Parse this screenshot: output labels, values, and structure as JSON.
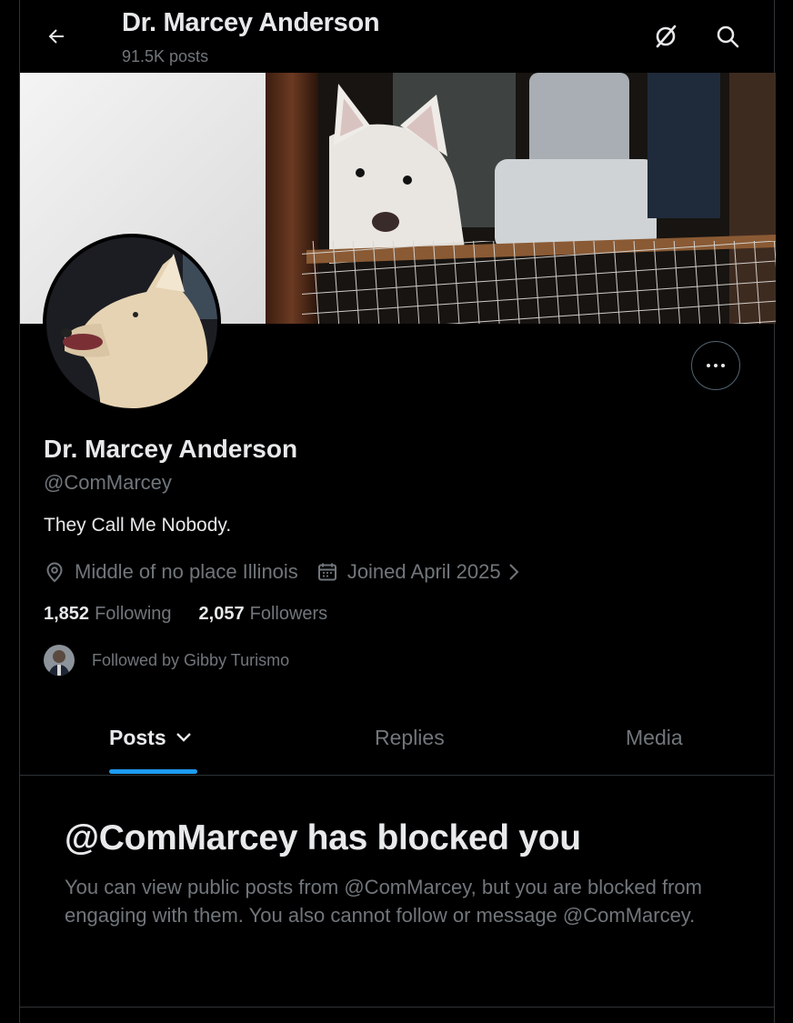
{
  "header": {
    "title": "Dr. Marcey Anderson",
    "post_count": "91.5K posts"
  },
  "profile": {
    "display_name": "Dr. Marcey Anderson",
    "handle": "@ComMarcey",
    "bio": "They Call Me Nobody.",
    "location": "Middle of no place Illinois",
    "joined": "Joined April 2025",
    "following_count": "1,852",
    "following_label": "Following",
    "followers_count": "2,057",
    "followers_label": "Followers",
    "followed_by": "Followed by Gibby Turismo"
  },
  "tabs": [
    {
      "label": "Posts",
      "active": true
    },
    {
      "label": "Replies",
      "active": false
    },
    {
      "label": "Media",
      "active": false
    }
  ],
  "blocked": {
    "title": "@ComMarcey has blocked you",
    "body": "You can view public posts from @ComMarcey, but you are blocked from engaging with them. You also cannot follow or message @ComMarcey."
  },
  "colors": {
    "background": "#000000",
    "primary_text": "#e7e9ea",
    "secondary_text": "#71767b",
    "accent": "#1d9bf0",
    "border": "#2f3336"
  },
  "icons": {
    "back": "arrow-left-icon",
    "grok": "grok-icon",
    "search": "search-icon",
    "more": "more-icon",
    "location": "location-pin-icon",
    "calendar": "calendar-icon",
    "chevron": "chevron-right-icon",
    "tab_dropdown": "chevron-down-icon"
  }
}
